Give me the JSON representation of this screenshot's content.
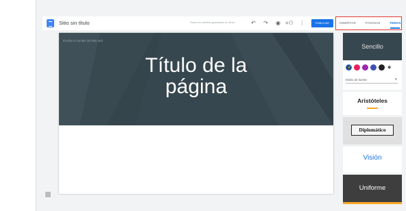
{
  "toolbar": {
    "site_title": "Sitio sin título",
    "save_status": "Todos los cambios guardados en Drive",
    "publish_label": "PUBLICAR",
    "undo_glyph": "↶",
    "redo_glyph": "↷",
    "preview_glyph": "◉",
    "share_glyph": "+⚇",
    "more_glyph": "⋮"
  },
  "tabs": {
    "insert": "INSERTAR",
    "pages": "PÁGINAS",
    "themes": "TEMAS"
  },
  "page": {
    "site_name_hint": "Escribe el nombre del sitio web",
    "title_line1": "Título de la",
    "title_line2": "página"
  },
  "themes": {
    "simple": "Sencillo",
    "font_style": "Estilo de fuente",
    "aristoteles": "Aristóteles",
    "diplomatico": "Diplomático",
    "vision": "Visión",
    "uniforme": "Uniforme",
    "swatches": [
      "#37474f",
      "#e91e63",
      "#9c27b0",
      "#3f51b5",
      "#212121"
    ],
    "colors": {
      "simple_bg": "#37474f",
      "aristoteles_accent": "#f9a825",
      "vision_text": "#1a73e8",
      "uniforme_bg": "#3e3e3e",
      "uniforme_accent": "#f9a825"
    }
  }
}
